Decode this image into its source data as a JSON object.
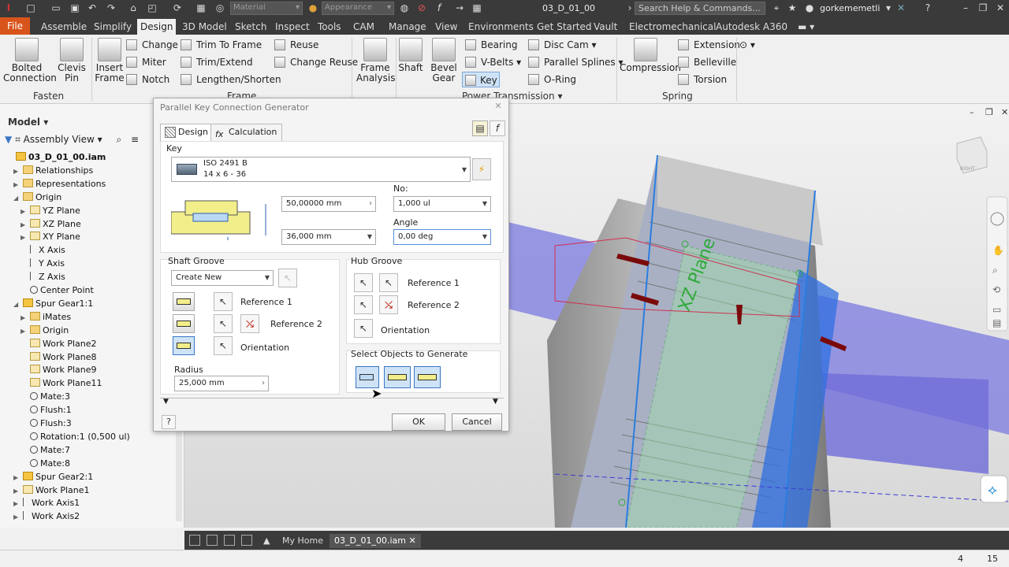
{
  "titlebar": {
    "material": "Material",
    "appearance": "Appearance",
    "document": "03_D_01_00",
    "search_placeholder": "Search Help & Commands...",
    "user": "gorkememetli"
  },
  "menu": {
    "file": "File",
    "tabs": [
      "Assemble",
      "Simplify",
      "Design",
      "3D Model",
      "Sketch",
      "Inspect",
      "Tools",
      "CAM",
      "Manage",
      "View",
      "Environments",
      "Get Started",
      "Vault",
      "Electromechanical",
      "Autodesk A360"
    ],
    "active": "Design"
  },
  "ribbon": {
    "bolted": "Bolted\nConnection",
    "clevis": "Clevis\nPin",
    "insert_frame": "Insert\nFrame",
    "change": "Change",
    "miter": "Miter",
    "notch": "Notch",
    "trim_to_frame": "Trim To Frame",
    "trim_extend": "Trim/Extend",
    "lengthen": "Lengthen/Shorten",
    "reuse": "Reuse",
    "change_reuse": "Change Reuse",
    "frame_analysis": "Frame\nAnalysis",
    "shaft": "Shaft",
    "bevel_gear": "Bevel\nGear",
    "bearing": "Bearing",
    "vbelts": "V-Belts",
    "key": "Key",
    "disc_cam": "Disc Cam",
    "parallel_splines": "Parallel Splines",
    "oring": "O-Ring",
    "compression": "Compression",
    "extension": "Extension",
    "belleville": "Belleville",
    "torsion": "Torsion",
    "panel_fasten": "Fasten",
    "panel_frame": "Frame",
    "panel_power": "Power Transmission",
    "panel_spring": "Spring"
  },
  "browser": {
    "title": "Model",
    "view": "Assembly View",
    "rows": [
      {
        "label": "03_D_01_00.iam",
        "indent": 0,
        "icon": "part",
        "bold": true,
        "tw": ""
      },
      {
        "label": "Relationships",
        "indent": 1,
        "icon": "folder",
        "tw": "▶"
      },
      {
        "label": "Representations",
        "indent": 1,
        "icon": "folder",
        "tw": "▶"
      },
      {
        "label": "Origin",
        "indent": 1,
        "icon": "folder",
        "tw": "◢"
      },
      {
        "label": "YZ Plane",
        "indent": 2,
        "icon": "plane",
        "tw": "▶"
      },
      {
        "label": "XZ Plane",
        "indent": 2,
        "icon": "plane",
        "tw": "▶"
      },
      {
        "label": "XY Plane",
        "indent": 2,
        "icon": "plane",
        "tw": "▶"
      },
      {
        "label": "X Axis",
        "indent": 2,
        "icon": "axis",
        "tw": ""
      },
      {
        "label": "Y Axis",
        "indent": 2,
        "icon": "axis",
        "tw": ""
      },
      {
        "label": "Z Axis",
        "indent": 2,
        "icon": "axis",
        "tw": ""
      },
      {
        "label": "Center Point",
        "indent": 2,
        "icon": "mate",
        "tw": ""
      },
      {
        "label": "Spur Gear1:1",
        "indent": 1,
        "icon": "part",
        "tw": "◢"
      },
      {
        "label": "iMates",
        "indent": 2,
        "icon": "folder",
        "tw": "▶"
      },
      {
        "label": "Origin",
        "indent": 2,
        "icon": "folder",
        "tw": "▶"
      },
      {
        "label": "Work Plane2",
        "indent": 2,
        "icon": "plane",
        "tw": ""
      },
      {
        "label": "Work Plane8",
        "indent": 2,
        "icon": "plane",
        "tw": ""
      },
      {
        "label": "Work Plane9",
        "indent": 2,
        "icon": "plane",
        "tw": ""
      },
      {
        "label": "Work Plane11",
        "indent": 2,
        "icon": "plane",
        "tw": ""
      },
      {
        "label": "Mate:3",
        "indent": 2,
        "icon": "mate",
        "tw": ""
      },
      {
        "label": "Flush:1",
        "indent": 2,
        "icon": "mate",
        "tw": ""
      },
      {
        "label": "Flush:3",
        "indent": 2,
        "icon": "mate",
        "tw": ""
      },
      {
        "label": "Rotation:1 (0,500 ul)",
        "indent": 2,
        "icon": "mate",
        "tw": ""
      },
      {
        "label": "Mate:7",
        "indent": 2,
        "icon": "mate",
        "tw": ""
      },
      {
        "label": "Mate:8",
        "indent": 2,
        "icon": "mate",
        "tw": ""
      },
      {
        "label": "Spur Gear2:1",
        "indent": 1,
        "icon": "part",
        "tw": "▶"
      },
      {
        "label": "Work Plane1",
        "indent": 1,
        "icon": "plane",
        "tw": "▶"
      },
      {
        "label": "Work Axis1",
        "indent": 1,
        "icon": "axis",
        "tw": "▶"
      },
      {
        "label": "Work Axis2",
        "indent": 1,
        "icon": "axis",
        "tw": "▶"
      }
    ]
  },
  "dialog": {
    "title": "Parallel Key Connection Generator",
    "tab_design": "Design",
    "tab_calc": "Calculation",
    "key_label": "Key",
    "key_standard": "ISO 2491 B",
    "key_size": "14 x 6 - 36",
    "length1": "50,00000 mm",
    "length2": "36,000 mm",
    "no_label": "No:",
    "no_value": "1,000 ul",
    "angle_label": "Angle",
    "angle_value": "0,00 deg",
    "shaft_groove": "Shaft Groove",
    "create_new": "Create New",
    "ref1": "Reference 1",
    "ref2": "Reference 2",
    "orientation": "Orientation",
    "radius_label": "Radius",
    "radius_value": "25,000 mm",
    "hub_groove": "Hub Groove",
    "select_objects": "Select Objects to Generate",
    "ok": "OK",
    "cancel": "Cancel"
  },
  "viewport": {
    "plane_label": "XZ Plane",
    "viewcube_label": "RIGHT"
  },
  "doctabs": {
    "home": "My Home",
    "doc": "03_D_01_00.iam"
  },
  "status": {
    "count1": "4",
    "count2": "15"
  }
}
